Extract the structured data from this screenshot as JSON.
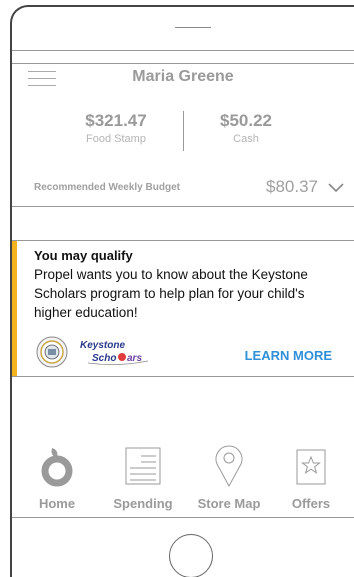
{
  "header": {
    "user_name": "Maria Greene"
  },
  "balances": {
    "food_stamp": {
      "amount": "$321.47",
      "label": "Food Stamp"
    },
    "cash": {
      "amount": "$50.22",
      "label": "Cash"
    }
  },
  "budget": {
    "label": "Recommended Weekly Budget",
    "amount": "$80.37"
  },
  "promo": {
    "title": "You may qualify",
    "body": "Propel wants you to know about the Keystone Scholars program to help plan for your child's higher education!",
    "logo_text_line1": "Keystone",
    "logo_text_line2": "Scholars",
    "cta": "LEARN MORE",
    "accent_color": "#f2b31f",
    "cta_color": "#2f8fd8"
  },
  "tabs": [
    {
      "label": "Home",
      "icon": "home-icon"
    },
    {
      "label": "Spending",
      "icon": "spending-icon"
    },
    {
      "label": "Store Map",
      "icon": "map-pin-icon"
    },
    {
      "label": "Offers",
      "icon": "offers-icon"
    }
  ]
}
